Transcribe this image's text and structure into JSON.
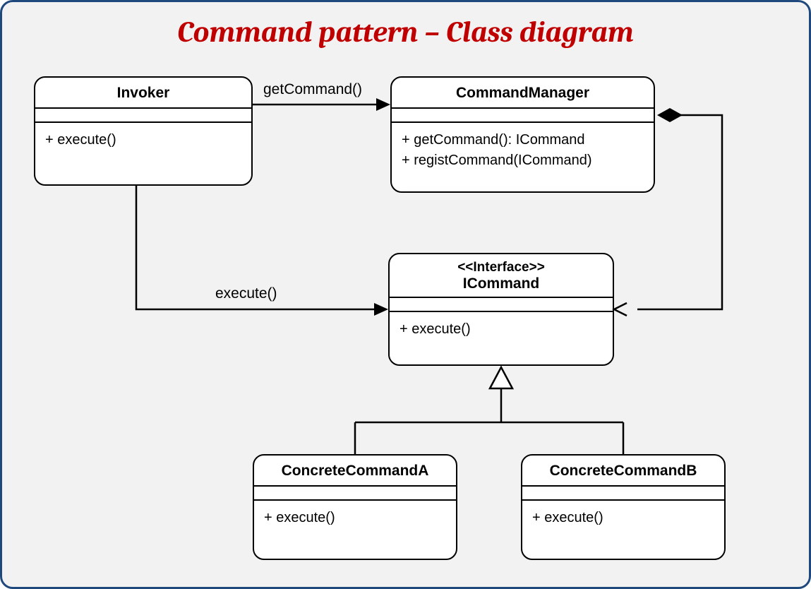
{
  "title": "Command pattern – Class diagram",
  "classes": {
    "invoker": {
      "name": "Invoker",
      "methods": [
        "+ execute()"
      ]
    },
    "commandManager": {
      "name": "CommandManager",
      "methods": [
        "+ getCommand(): ICommand",
        "+ registCommand(ICommand)"
      ]
    },
    "icommand": {
      "stereotype": "<<Interface>>",
      "name": "ICommand",
      "methods": [
        "+ execute()"
      ]
    },
    "concreteA": {
      "name": "ConcreteCommandA",
      "methods": [
        "+ execute()"
      ]
    },
    "concreteB": {
      "name": "ConcreteCommandB",
      "methods": [
        "+ execute()"
      ]
    }
  },
  "edges": {
    "invokerToManager": {
      "label": "getCommand()"
    },
    "invokerToICommand": {
      "label": "execute()"
    }
  }
}
